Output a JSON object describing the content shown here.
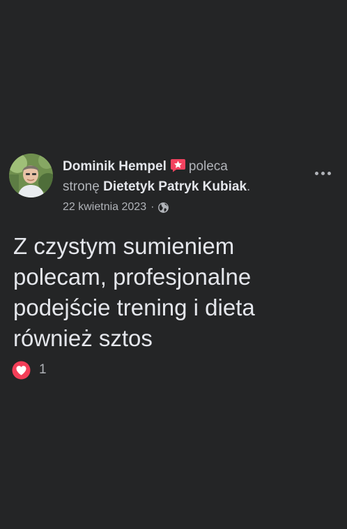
{
  "post": {
    "author": "Dominik Hempel",
    "recommend_text": "poleca",
    "page_prefix": "stronę",
    "page_name": "Dietetyk Patryk Kubiak",
    "page_suffix": ".",
    "date": "22 kwietnia 2023",
    "separator": "·",
    "privacy_icon": "globe-icon",
    "body": "Z czystym sumieniem\npolecam, profesjonalne\npodejście trening i dieta\nrównież sztos",
    "reactions": {
      "icon": "heart-icon",
      "count": "1"
    }
  },
  "colors": {
    "background": "#242526",
    "primary_text": "#e4e6eb",
    "secondary_text": "#b0b3b8",
    "recommend_badge": "#f3425f",
    "love_reaction": "#f33e58"
  }
}
